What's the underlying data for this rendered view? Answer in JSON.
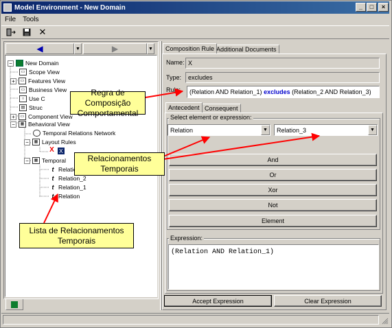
{
  "window": {
    "title": "Model Environment - New Domain",
    "controls": {
      "min": "_",
      "max": "□",
      "close": "×"
    }
  },
  "menu": {
    "file": "File",
    "tools": "Tools"
  },
  "nav": {
    "back_icon": "◀",
    "forward_icon": "▶"
  },
  "tree": {
    "items": [
      {
        "label": "New Domain"
      },
      {
        "label": "Scope View"
      },
      {
        "label": "Features View"
      },
      {
        "label": "Business View"
      },
      {
        "label": "Use C"
      },
      {
        "label": "Struc"
      },
      {
        "label": "Component View"
      },
      {
        "label": "Behavioral View"
      },
      {
        "label": "Temporal Relations Network"
      },
      {
        "label": "Layout Rules"
      },
      {
        "label": "X"
      },
      {
        "label": "Temporal"
      },
      {
        "label": "Relation"
      },
      {
        "label": "Relation_2"
      },
      {
        "label": "Relation_1"
      },
      {
        "label": "Relation"
      }
    ]
  },
  "tabs": {
    "composition": "Composition Rule",
    "additional": "Additional Documents"
  },
  "form": {
    "name_label": "Name:",
    "name_value": "X",
    "type_label": "Type:",
    "type_value": "excludes",
    "rule_label": "Rule:",
    "rule_pre": "(Relation AND Relation_1) ",
    "rule_op": "excludes",
    "rule_post": " (Relation_2 AND Relation_3)"
  },
  "subtabs": {
    "antecedent": "Antecedent",
    "consequent": "Consequent"
  },
  "select": {
    "group_label": "Select element or expression:",
    "left_value": "Relation",
    "right_value": "Relation_3"
  },
  "buttons": {
    "and": "And",
    "or": "Or",
    "xor": "Xor",
    "not": "Not",
    "element": "Element",
    "accept": "Accept Expression",
    "clear": "Clear Expression"
  },
  "expression": {
    "label": "Expression:",
    "value": "(Relation AND Relation_1)"
  },
  "callouts": {
    "regra": "Regra de Composição Comportamental",
    "relacionamentos": "Relacionamentos Temporais",
    "lista": "Lista de Relacionamentos Temporais"
  },
  "colors": {
    "title_bar": "#0a246a",
    "callout_bg": "#ffff99",
    "arrow": "#ff0000",
    "op_blue": "#0000cc",
    "nav_arrow": "#0000b0"
  }
}
